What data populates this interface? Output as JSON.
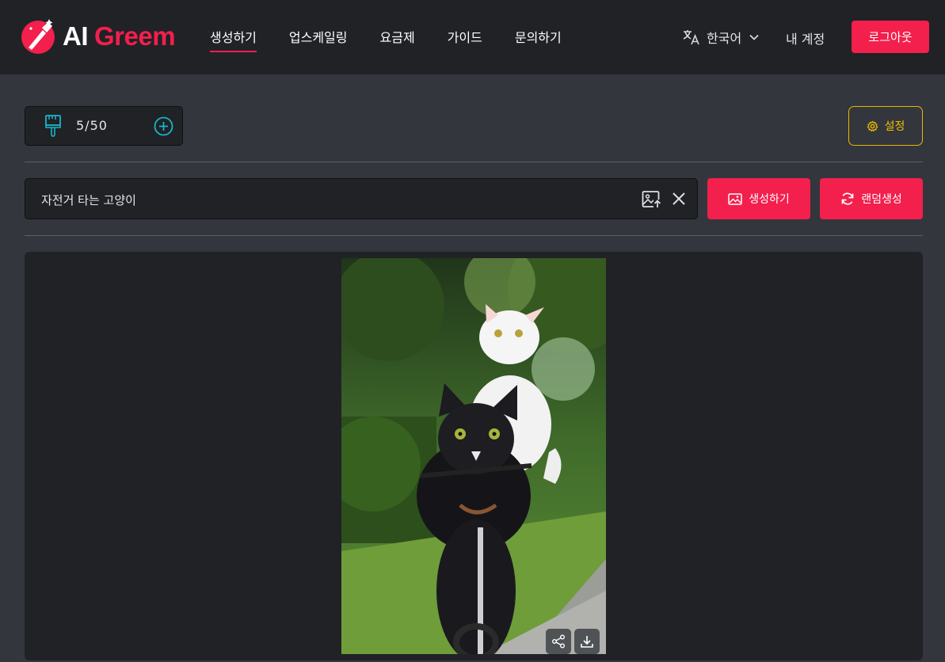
{
  "header": {
    "logo": {
      "part1": "AI",
      "part2": "Greem",
      "icon": "brush-logo-icon"
    },
    "nav": [
      {
        "label": "생성하기",
        "active": true
      },
      {
        "label": "업스케일링",
        "active": false
      },
      {
        "label": "요금제",
        "active": false
      },
      {
        "label": "가이드",
        "active": false
      },
      {
        "label": "문의하기",
        "active": false
      }
    ],
    "language": "한국어",
    "account": "내 계정",
    "logout": "로그아웃"
  },
  "credits": {
    "count": "5/50",
    "icon": "brush-icon",
    "add_icon": "plus-circle-icon"
  },
  "settings": {
    "label": "설정",
    "icon": "gear-icon"
  },
  "prompt": {
    "value": "자전거 타는 고양이"
  },
  "buttons": {
    "generate": "생성하기",
    "random": "랜덤생성"
  },
  "colors": {
    "accent": "#f31f4c",
    "settings": "#f0c000",
    "credit_icon": "#17b6c9",
    "header_bg": "#202226",
    "page_bg": "#33363d"
  },
  "result": {
    "image_subject": "cats-on-bicycle-image",
    "actions": [
      "share-icon",
      "download-icon"
    ]
  }
}
